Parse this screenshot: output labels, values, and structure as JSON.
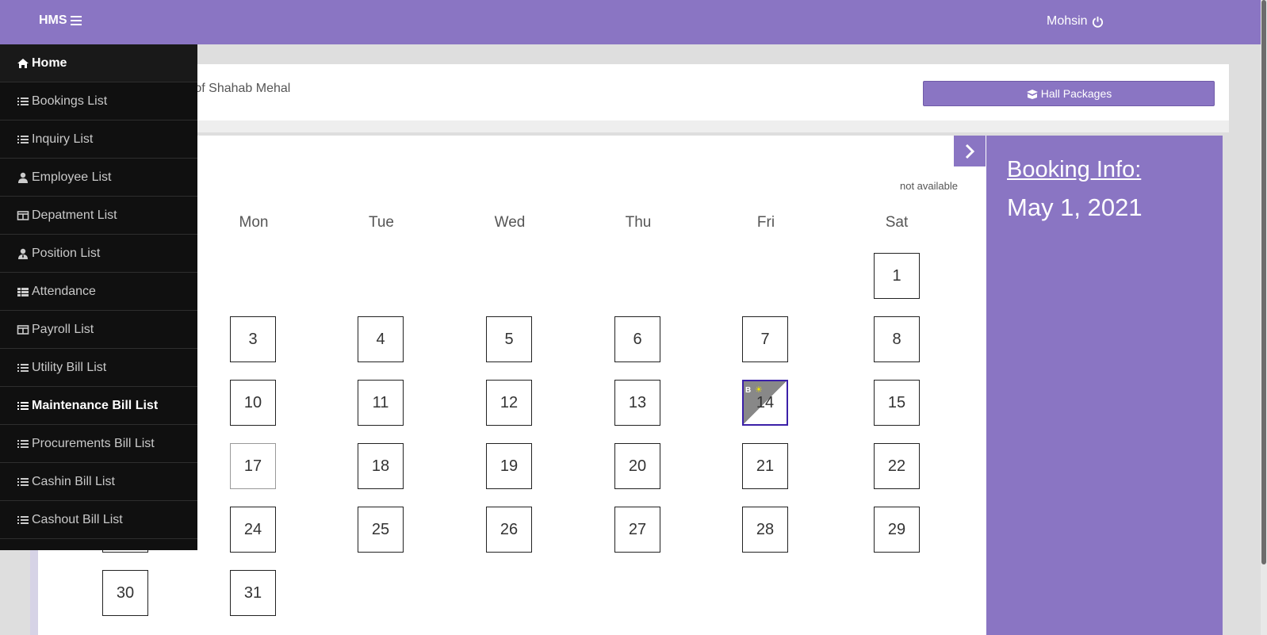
{
  "app": {
    "brand": "HMS",
    "user_name": "Mohsin"
  },
  "header": {
    "welcome_text": "nager of Shahab Mehal",
    "hall_packages_label": "Hall Packages"
  },
  "sidebar": {
    "items": [
      {
        "label": "Home",
        "icon": "home-icon"
      },
      {
        "label": "Bookings List",
        "icon": "list-icon"
      },
      {
        "label": "Inquiry List",
        "icon": "list-icon"
      },
      {
        "label": "Employee List",
        "icon": "user-icon"
      },
      {
        "label": "Depatment List",
        "icon": "columns-icon"
      },
      {
        "label": "Position List",
        "icon": "user-tie-icon"
      },
      {
        "label": "Attendance",
        "icon": "table-list-icon"
      },
      {
        "label": "Payroll List",
        "icon": "columns-icon"
      },
      {
        "label": "Utility Bill List",
        "icon": "list-icon"
      },
      {
        "label": "Maintenance Bill List",
        "icon": "list-icon"
      },
      {
        "label": "Procurements Bill List",
        "icon": "list-icon"
      },
      {
        "label": "Cashin Bill List",
        "icon": "list-icon"
      },
      {
        "label": "Cashout Bill List",
        "icon": "list-icon"
      }
    ],
    "active_item": "Maintenance Bill List"
  },
  "calendar": {
    "legend": "not available",
    "weekdays": [
      "Mon",
      "Tue",
      "Wed",
      "Thu",
      "Fri",
      "Sat"
    ],
    "days": [
      "1",
      "3",
      "4",
      "5",
      "6",
      "7",
      "8",
      "10",
      "11",
      "12",
      "13",
      "14",
      "15",
      "17",
      "18",
      "19",
      "20",
      "21",
      "22",
      "24",
      "25",
      "26",
      "27",
      "28",
      "29",
      "30",
      "31"
    ],
    "booked_day": "14",
    "booked_marker": "B",
    "booked_icon": "sun-icon"
  },
  "booking_panel": {
    "title": "Booking Info:",
    "date": "May 1, 2021"
  },
  "colors": {
    "accent": "#8a75c3",
    "sidebar": "#101010",
    "booked_border": "#3b20a8"
  }
}
